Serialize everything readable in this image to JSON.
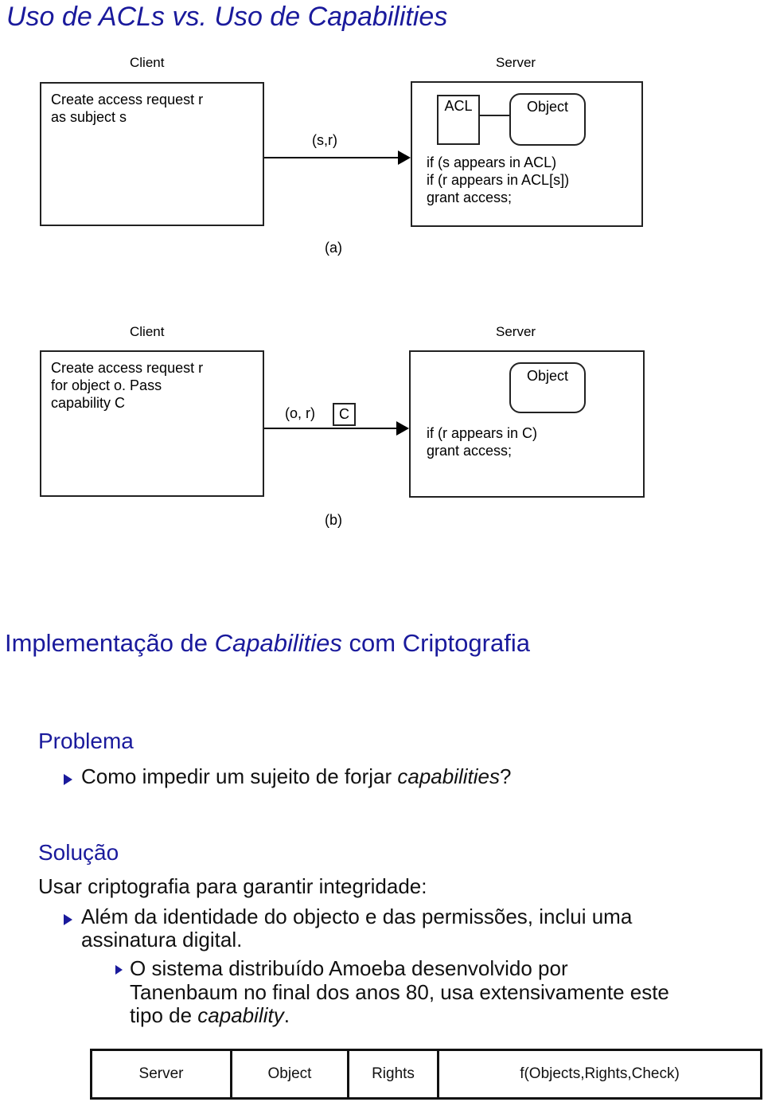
{
  "slide": {
    "title": "Uso de ACLs vs. Uso de Capabilities"
  },
  "figure_a": {
    "label": "(a)",
    "client_caption": "Client",
    "server_caption": "Server",
    "client_text": "Create access request r\nas subject s",
    "message_label": "(s,r)",
    "acl_box_label": "ACL",
    "object_box_label": "Object",
    "server_text": "if (s appears in ACL)\n  if (r appears in ACL[s])\n    grant access;"
  },
  "figure_b": {
    "label": "(b)",
    "client_caption": "Client",
    "server_caption": "Server",
    "client_text": "Create access request r\nfor object o. Pass\ncapability C",
    "message_label": "(o, r)",
    "capability_box_label": "C",
    "object_box_label": "Object",
    "server_text": "if (r appears in C)\n  grant access;"
  },
  "section": {
    "heading_prefix": "Implementação de ",
    "heading_italic": "Capabilities",
    "heading_suffix": " com Criptografia"
  },
  "problem": {
    "heading": "Problema",
    "bullet_prefix": "Como impedir um sujeito de forjar ",
    "bullet_italic": "capabilities",
    "bullet_suffix": "?"
  },
  "solution": {
    "heading": "Solução",
    "intro": "Usar criptografia para garantir integridade:",
    "bullet1": "Além da identidade do objecto e das permissões, inclui uma assinatura digital.",
    "bullet2_line1": "O sistema distribuído Amoeba desenvolvido por",
    "bullet2_line2": "Tanenbaum no final dos anos 80, usa extensivamente este",
    "bullet2_line3_prefix": "tipo de ",
    "bullet2_line3_italic": "capability",
    "bullet2_line3_suffix": "."
  },
  "capability_table": {
    "cells": [
      "Server",
      "Object",
      "Rights",
      "f(Objects,Rights,Check)"
    ]
  },
  "colors": {
    "accent_blue": "#1a1a9c",
    "ink": "#111111"
  }
}
